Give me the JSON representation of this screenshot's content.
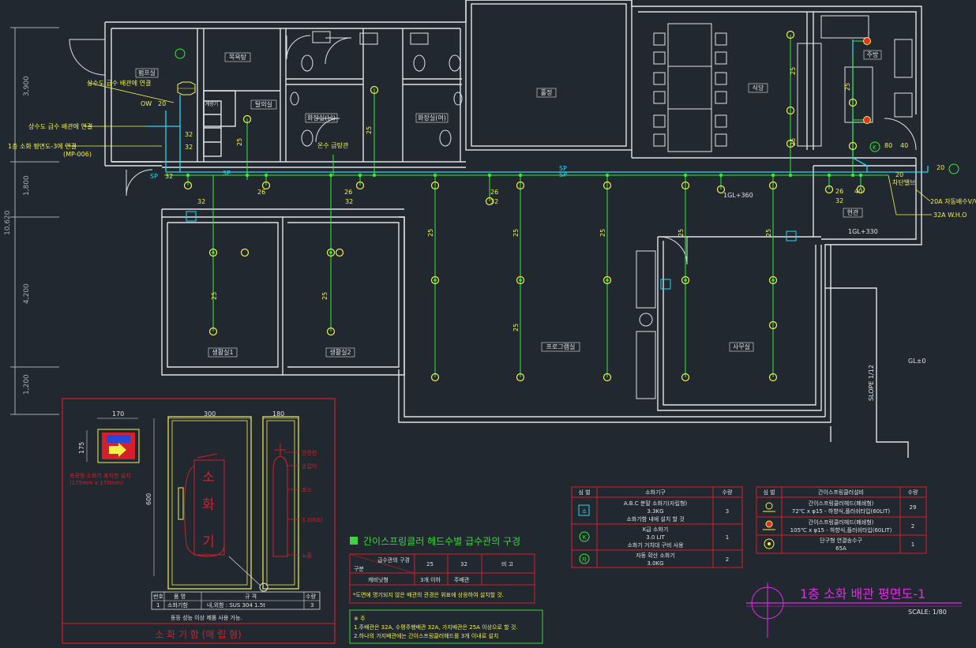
{
  "colors": {
    "background": "#212830",
    "wall": "#dfe3e7",
    "pipe_main": "#29d6ee",
    "pipe_branch": "#33ee33",
    "text_yellow": "#f2f24a",
    "frame_red": "#d51f2a",
    "note_green": "#3fd13f",
    "title_magenta": "#e22be2",
    "dim_gray": "#a6acb3"
  },
  "rooms": {
    "pump": "펌프실",
    "shower": "목욕탕",
    "laundry": "탈의실",
    "wc_m": "화장실(남)",
    "wc_f": "화장실(여)",
    "hall": "홀정",
    "dining": "식당",
    "kitchen": "주방",
    "entrance": "현관",
    "room1": "생활실1",
    "room2": "생활실2",
    "program": "프로그램실",
    "office": "사무실",
    "small_room": "계량기"
  },
  "levels": {
    "gl1": "1GL+360",
    "gl2": "1GL+330",
    "gl0": "GL±0"
  },
  "annotations": {
    "supply1": "상수도 급수 배관에 연결",
    "supply2": "상수도 급수 배관에 연결",
    "connect": "1층 소화 평면도-3에 연결",
    "connect_ref": "(MP-006)",
    "ow": "OW",
    "sp": "SP",
    "water_heater": "온수 급탕관",
    "valve": "차단밸브",
    "v20": "20A 자동배수V/V",
    "v32": "32A W.H.O",
    "slope": "SLOPE 1/12",
    "hydrant_badge": "소화기함",
    "cabinet_note": "소화기함"
  },
  "pipe_sizes": {
    "s20": "20",
    "s25": "25",
    "s26": "26",
    "s32": "32",
    "s40": "40",
    "s80": "80"
  },
  "dims_left": [
    "3,900",
    "1,800",
    "10,620",
    "4,200",
    "1,200"
  ],
  "cabinet": {
    "title": "소 화 기 함 (매 립 형)",
    "dim_170": "170",
    "dim_300": "300",
    "dim_180": "180",
    "dim_175": "175",
    "dim_600": "600",
    "sign_note": "축광형 소화기 표지판 설치",
    "sign_size": "(175mm x 170mm)",
    "letters": [
      "소",
      "화",
      "기"
    ],
    "callouts": [
      "안전핀",
      "손잡이",
      "호스",
      "3.3(KG)",
      "노즐"
    ],
    "table_headers": [
      "번호",
      "품 명",
      "규 격",
      "수량"
    ],
    "table_row": [
      "1",
      "소화기함",
      "내,외함 : SUS 304 1.5t",
      "3"
    ],
    "note": "동등 성능 이상 제품 사용 가능."
  },
  "sprinkler_table": {
    "heading": "간이스프링클러 헤드수별 급수관의 구경",
    "h_top": "급수관의 구경",
    "h_left": "구분",
    "cols": [
      "25",
      "32",
      "비 고"
    ],
    "row_label": "캐비닛형",
    "row_vals": [
      "3개 이하",
      "주배관"
    ],
    "footnote": "*도면에 명기되지 않은 배관의 관경은 위표에 상응하여 설치할 것."
  },
  "notes": {
    "title": "※ 주",
    "line1": "1.주배관은 32A, 수평주행배관 32A, 가지배관은 25A 이상으로 할 것.",
    "line2": "2.하나의 가지배관에는 간이스프링클러헤드를 3개 이내로 설치"
  },
  "legend_ext": {
    "headers": [
      "심 벌",
      "소화기구",
      "수량"
    ],
    "rows": [
      {
        "symbol": "소",
        "lines": [
          "A.B.C 분말 소화기(자립형)",
          "3.3KG",
          "소화기함 내에 설치 할 것"
        ],
        "qty": "3"
      },
      {
        "symbol": "K",
        "lines": [
          "K급 소화기",
          "3.0 LIT",
          "소화기 거치대 구비 사용"
        ],
        "qty": "1"
      },
      {
        "symbol": "자",
        "lines": [
          "자동 확산 소화기",
          "3.0KG"
        ],
        "qty": "2"
      }
    ]
  },
  "legend_spr": {
    "headers": [
      "심 벌",
      "간이스프링클러설비",
      "수량"
    ],
    "rows": [
      {
        "lines": [
          "간이스프링클러헤드(폐쇄형)",
          "72℃ x φ15 - 하향식,플러쉬타입(60LIT)"
        ],
        "qty": "29"
      },
      {
        "lines": [
          "간이스프링클러헤드(폐쇄형)",
          "105℃ x φ15 - 하향식,플러쉬타입(60LIT)"
        ],
        "qty": "2"
      },
      {
        "lines": [
          "단구형 연결송수구",
          "65A"
        ],
        "qty": "1"
      }
    ]
  },
  "drawing_title": {
    "title": "1층 소화 배관 평면도-1",
    "scale": "SCALE: 1/80"
  }
}
